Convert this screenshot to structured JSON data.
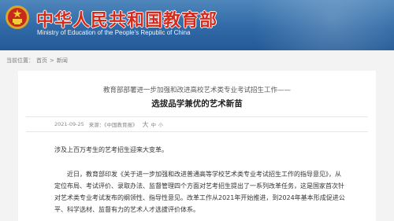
{
  "header": {
    "title_cn": "中华人民共和国教育部",
    "title_en": "Ministry of Education of the People's Republic of China",
    "emblem_icon": "national-emblem-icon",
    "primary_color": "#2f69a6",
    "title_color": "#d62a1b"
  },
  "breadcrumb": {
    "prefix": "当前位置：",
    "home": "首页",
    "separator": ">",
    "current": "新闻"
  },
  "article": {
    "pre_title": "教育部部署进一步加强和改进高校艺术类专业考试招生工作——",
    "title": "选拔品学兼优的艺术新苗",
    "date": "2021-09-25",
    "source": "来源：《中国教育报》",
    "font_large": "大",
    "font_medium": "中",
    "font_small": "小",
    "paragraph_1": "涉及上百万考生的艺考招生迎来大变革。",
    "paragraph_2": "近日，教育部印发《关于进一步加强和改进普通高等学校艺术类专业考试招生工作的指导意见》，从定位布局、考试评价、录取办法、监督管理四个方面对艺考招生提出了一系列改革任务，这是国家首次针对艺术类专业考试发布的纲领性、指导性意见。改革工作从2021年开始推进，到2024年基本形成促进公平、科学选材、监督有力的艺术人才选拔评价体系。"
  }
}
